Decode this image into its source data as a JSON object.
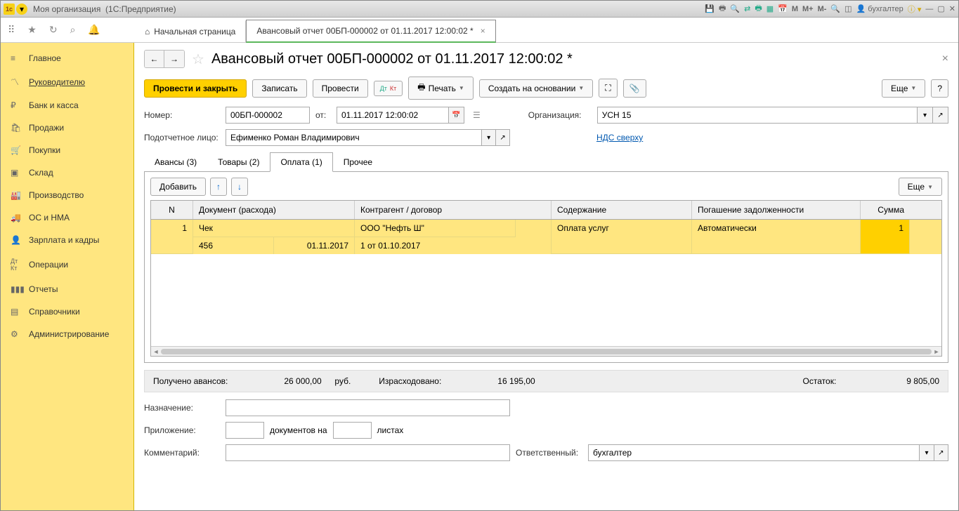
{
  "titlebar": {
    "org": "Моя организация",
    "app": "(1С:Предприятие)",
    "user": "бухгалтер",
    "m": "M",
    "mplus": "M+",
    "mminus": "M-"
  },
  "topbar": {
    "home_tab": "Начальная страница",
    "doc_tab": "Авансовый отчет 00БП-000002 от 01.11.2017 12:00:02 *"
  },
  "sidebar": {
    "items": [
      {
        "icon": "≡",
        "label": "Главное"
      },
      {
        "icon": "📈",
        "label": "Руководителю",
        "active": true
      },
      {
        "icon": "₽",
        "label": "Банк и касса"
      },
      {
        "icon": "🛍",
        "label": "Продажи"
      },
      {
        "icon": "🛒",
        "label": "Покупки"
      },
      {
        "icon": "📦",
        "label": "Склад"
      },
      {
        "icon": "🏭",
        "label": "Производство"
      },
      {
        "icon": "🚚",
        "label": "ОС и НМА"
      },
      {
        "icon": "👤",
        "label": "Зарплата и кадры"
      },
      {
        "icon": "Дт",
        "label": "Операции"
      },
      {
        "icon": "📊",
        "label": "Отчеты"
      },
      {
        "icon": "📚",
        "label": "Справочники"
      },
      {
        "icon": "⚙",
        "label": "Администрирование"
      }
    ]
  },
  "doc": {
    "title": "Авансовый отчет 00БП-000002 от 01.11.2017 12:00:02 *",
    "buttons": {
      "post_close": "Провести и закрыть",
      "save": "Записать",
      "post": "Провести",
      "print": "Печать",
      "create_based": "Создать на основании",
      "more": "Еще"
    },
    "fields": {
      "number_label": "Номер:",
      "number": "00БП-000002",
      "from_label": "от:",
      "date": "01.11.2017 12:00:02",
      "org_label": "Организация:",
      "org": "УСН 15",
      "person_label": "Подотчетное лицо:",
      "person": "Ефименко Роман Владимирович",
      "vat_link": "НДС сверху"
    },
    "tabs": {
      "advances": "Авансы (3)",
      "goods": "Товары (2)",
      "payment": "Оплата (1)",
      "other": "Прочее"
    },
    "panel": {
      "add": "Добавить",
      "more": "Еще",
      "cols": {
        "n": "N",
        "doc": "Документ (расхода)",
        "contr": "Контрагент / договор",
        "sod": "Содержание",
        "pog": "Погашение задолженности",
        "sum": "Сумма"
      },
      "row": {
        "n": "1",
        "doc_type": "Чек",
        "doc_num": "456",
        "doc_date": "01.11.2017",
        "contr": "ООО \"Нефть Ш\"",
        "contract": "1 от 01.10.2017",
        "sod": "Оплата услуг",
        "pog": "Автоматически",
        "sum": "1"
      }
    },
    "summary": {
      "received_label": "Получено авансов:",
      "received": "26 000,00",
      "currency": "руб.",
      "spent_label": "Израсходовано:",
      "spent": "16 195,00",
      "balance_label": "Остаток:",
      "balance": "9 805,00"
    },
    "bottom": {
      "purpose_label": "Назначение:",
      "attach_label": "Приложение:",
      "docs_on": "документов на",
      "sheets": "листах",
      "comment_label": "Комментарий:",
      "resp_label": "Ответственный:",
      "resp": "бухгалтер"
    }
  }
}
